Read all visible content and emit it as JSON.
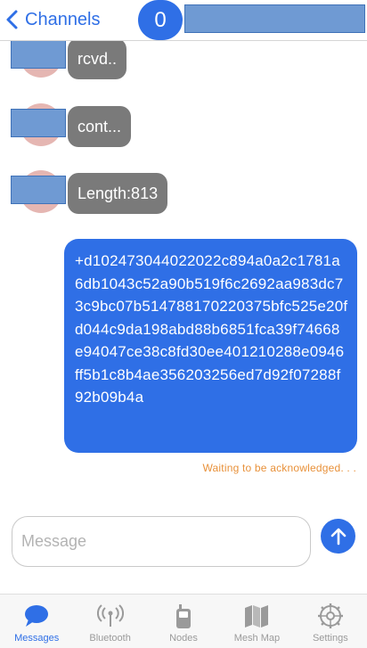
{
  "header": {
    "back_label": "Channels",
    "count": "0"
  },
  "messages": [
    {
      "direction": "in",
      "text": "rcvd.."
    },
    {
      "direction": "in",
      "text": "cont..."
    },
    {
      "direction": "in",
      "text": "Length:813"
    },
    {
      "direction": "out",
      "text": "+d102473044022022c894a0a2c1781a6db1043c52a90b519f6c2692aa983dc73c9bc07b514788170220375bfc525e20fd044c9da198abd88b6851fca39f74668e94047ce38c8fd30ee401210288e0946ff5b1c8b4ae356203256ed7d92f07288f92b09b4a",
      "status": "Waiting to be acknowledged. . ."
    }
  ],
  "composer": {
    "placeholder": "Message"
  },
  "tabs": [
    {
      "label": "Messages",
      "icon": "chat-bubble-icon",
      "active": true
    },
    {
      "label": "Bluetooth",
      "icon": "antenna-icon",
      "active": false
    },
    {
      "label": "Nodes",
      "icon": "handheld-radio-icon",
      "active": false
    },
    {
      "label": "Mesh Map",
      "icon": "map-icon",
      "active": false
    },
    {
      "label": "Settings",
      "icon": "gear-icon",
      "active": false
    }
  ],
  "colors": {
    "accent": "#2f6fe6",
    "incoming_bubble": "#7a7a7a",
    "status": "#e8913a"
  }
}
